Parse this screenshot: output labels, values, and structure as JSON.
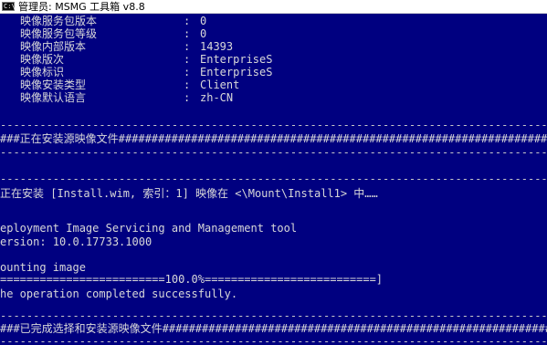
{
  "window": {
    "title": "管理员:  MSMG 工具箱 v8.8",
    "icon_text": "C:\\"
  },
  "image_info": [
    {
      "key": "映像服务包版本",
      "value": "0"
    },
    {
      "key": "映像服务包等级",
      "value": "0"
    },
    {
      "key": "映像内部版本",
      "value": "14393"
    },
    {
      "key": "映像版次",
      "value": "EnterpriseS"
    },
    {
      "key": "映像标识",
      "value": "EnterpriseS"
    },
    {
      "key": "映像安装类型",
      "value": "Client"
    },
    {
      "key": "映像默认语言",
      "value": "zh-CN"
    }
  ],
  "separator": ":",
  "rule": "------------------------------------------------------------------------------------------------------------------------",
  "banner_start": "###正在安装源映像文件########################################################################################################",
  "install_msg": "正在安装 [Install.wim, 索引：1] 映像在 <\\Mount\\Install1> 中……",
  "dism_title": "eployment Image Servicing and Management tool",
  "dism_version": "ersion: 10.0.17733.1000",
  "mounting": "ounting image",
  "progress_bar": "=========================100.0%==========================]",
  "completed": "he operation completed successfully.",
  "banner_done": "###已完成选择和安装源映像文件################################################################################################",
  "colors": {
    "background": "#000080",
    "text": "#d8d8d8",
    "titlebar": "#ffffff"
  }
}
